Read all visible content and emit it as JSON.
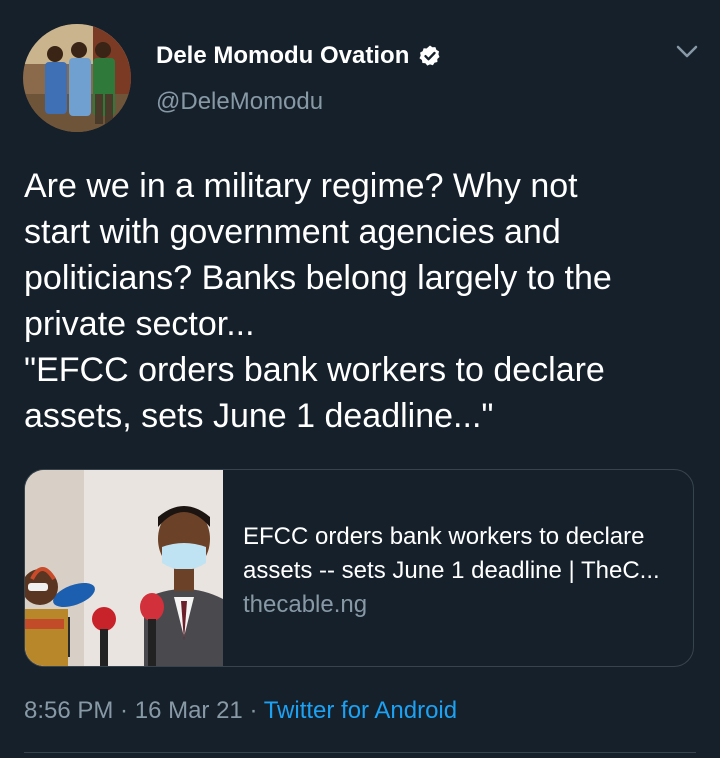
{
  "author": {
    "display_name": "Dele Momodu Ovation",
    "handle": "@DeleMomodu",
    "verified": true,
    "avatar_icon": "profile-photo"
  },
  "tweet": {
    "text_lines": [
      "Are we in a military regime? Why not",
      "start with government agencies and",
      "politicians? Banks belong largely to the",
      "private sector...",
      "\"EFCC orders bank workers to declare",
      "assets, sets June 1 deadline...\""
    ]
  },
  "link_card": {
    "title_lines": [
      "EFCC orders bank workers to declare",
      "assets -- sets June 1 deadline | TheC..."
    ],
    "domain": "thecable.ng"
  },
  "meta": {
    "time": "8:56 PM",
    "separator": " · ",
    "date": "16 Mar 21",
    "source": "Twitter for Android"
  },
  "colors": {
    "background": "#15202b",
    "text": "#ffffff",
    "secondary": "#8899a6",
    "link": "#1da1f2",
    "border": "#38444d"
  }
}
